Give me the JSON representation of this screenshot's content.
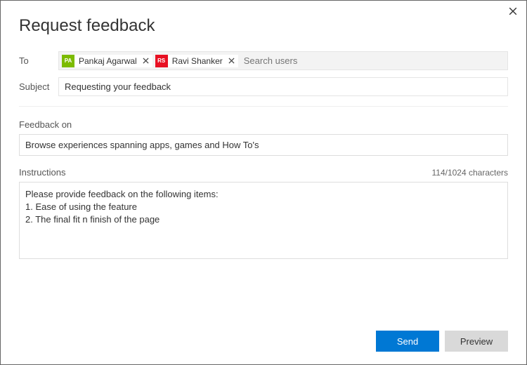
{
  "title": "Request feedback",
  "to": {
    "label": "To",
    "chips": [
      {
        "initials": "PA",
        "name": "Pankaj Agarwal",
        "color": "#7cbb00"
      },
      {
        "initials": "RS",
        "name": "Ravi Shanker",
        "color": "#e81123"
      }
    ],
    "search_placeholder": "Search users"
  },
  "subject": {
    "label": "Subject",
    "value": "Requesting your feedback"
  },
  "feedback_on": {
    "label": "Feedback on",
    "value": "Browse experiences spanning apps, games and How To's"
  },
  "instructions": {
    "label": "Instructions",
    "char_count_text": "114/1024 characters",
    "value": "Please provide feedback on the following items:\n1. Ease of using the feature\n2. The final fit n finish of the page"
  },
  "buttons": {
    "send": "Send",
    "preview": "Preview"
  }
}
